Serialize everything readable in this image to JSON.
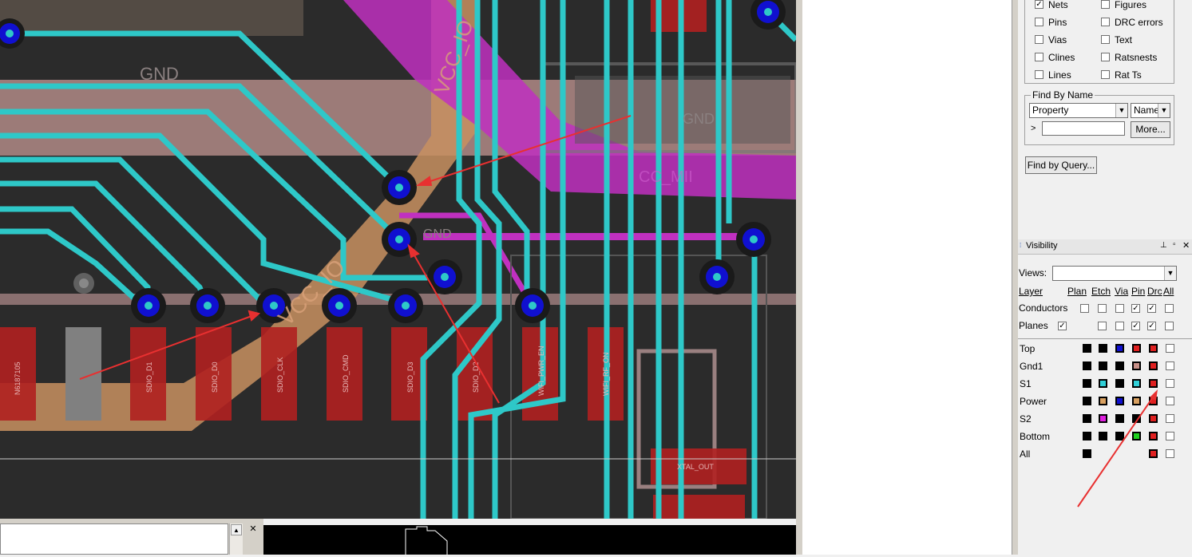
{
  "pcb": {
    "pad_labels": [
      "N6187105",
      "SDIO_D1",
      "SDIO_D0",
      "SDIO_CLK",
      "SDIO_CMD",
      "SDIO_D3",
      "SDIO_D2",
      "WIFI_PWR_EN",
      "WIFI_RF_ON"
    ],
    "net_labels": {
      "vcc_io_top": "VCC_IO",
      "vcc_io_diag": "VCC_IO",
      "gnd_top": "GND",
      "gnd_mid": "GND",
      "gnd_small": "GND",
      "cc_mid": "CC_MII",
      "xtal": "XTAL_OUT"
    }
  },
  "find_panel": {
    "checkboxes_left": [
      {
        "label": "Nets",
        "checked": true
      },
      {
        "label": "Pins",
        "checked": false
      },
      {
        "label": "Vias",
        "checked": false
      },
      {
        "label": "Clines",
        "checked": false
      },
      {
        "label": "Lines",
        "checked": false
      }
    ],
    "checkboxes_right": [
      {
        "label": "Figures",
        "checked": false
      },
      {
        "label": "DRC errors",
        "checked": false
      },
      {
        "label": "Text",
        "checked": false
      },
      {
        "label": "Ratsnests",
        "checked": false
      },
      {
        "label": "Rat Ts",
        "checked": false
      }
    ],
    "find_by_name": {
      "group_label": "Find By Name",
      "property_value": "Property",
      "name_value": "Name",
      "prompt": ">",
      "input_value": "",
      "more_label": "More..."
    },
    "find_by_query_label": "Find by Query..."
  },
  "visibility": {
    "title": "Visibility",
    "views_label": "Views:",
    "views_value": "",
    "header": {
      "layer": "Layer",
      "plan": "Plan",
      "etch": "Etch",
      "via": "Via",
      "pin": "Pin",
      "drc": "Drc",
      "all": "All"
    },
    "class_rows": [
      {
        "label": "Conductors",
        "plan": false,
        "etch": false,
        "via": false,
        "pin": true,
        "drc": true,
        "all": false
      },
      {
        "label": "Planes",
        "plan": true,
        "etch": false,
        "via": false,
        "pin": true,
        "drc": true,
        "all": false
      }
    ],
    "layer_rows": [
      {
        "label": "Top",
        "colors": [
          "#000000",
          "#000000",
          "#1010d0",
          "#e02020",
          "#e02020"
        ]
      },
      {
        "label": "Gnd1",
        "colors": [
          "#000000",
          "#000000",
          "#000000",
          "#c89088",
          "#e02020"
        ]
      },
      {
        "label": "S1",
        "colors": [
          "#000000",
          "#30d0d8",
          "#000000",
          "#30d0d8",
          "#e02020"
        ]
      },
      {
        "label": "Power",
        "colors": [
          "#000000",
          "#d8a060",
          "#1010d0",
          "#d8a060",
          "#e02020"
        ]
      },
      {
        "label": "S2",
        "colors": [
          "#000000",
          "#e020e0",
          "#000000",
          "#000000",
          "#e02020"
        ]
      },
      {
        "label": "Bottom",
        "colors": [
          "#000000",
          "#000000",
          "#000000",
          "#20d020",
          "#e02020"
        ]
      },
      {
        "label": "All",
        "colors": [
          "#000000",
          null,
          null,
          null,
          "#e02020"
        ]
      }
    ]
  }
}
